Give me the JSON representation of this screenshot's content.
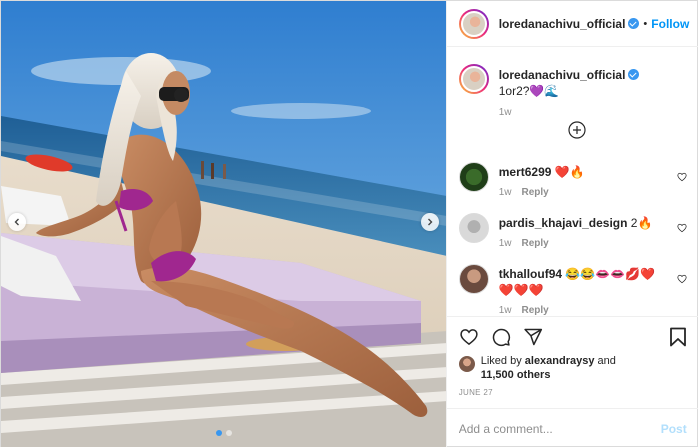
{
  "post": {
    "username": "loredanachivu_official",
    "follow_label": "Follow",
    "bullet": "•",
    "caption": "1or2?💜🌊",
    "caption_age": "1w",
    "comments": [
      {
        "user": "mert6299",
        "text": "❤️🔥",
        "age": "1w",
        "reply": "Reply"
      },
      {
        "user": "pardis_khajavi_design",
        "text": "2🔥",
        "age": "1w",
        "reply": "Reply"
      },
      {
        "user": "tkhallouf94",
        "text": "😂😂👄👄💋❤️❤️❤️❤️",
        "age": "1w",
        "reply": "Reply"
      }
    ],
    "liked_by_prefix": "Liked by",
    "liked_by_user": "alexandraysy",
    "liked_by_and": "and",
    "likes_count": "11,500 others",
    "date": "JUNE 27",
    "comment_placeholder": "Add a comment...",
    "post_label": "Post"
  },
  "carousel": {
    "slide_count": 2,
    "active_slide": 1
  },
  "colors": {
    "accent": "#0095f6",
    "verified": "#3897f0",
    "post_disabled": "#b2dffc",
    "muted": "#8e8e8e"
  },
  "icons": [
    "chevron-left-icon",
    "chevron-right-icon",
    "verified-badge-icon",
    "add-circle-icon",
    "heart-icon",
    "comment-icon",
    "share-icon",
    "bookmark-icon"
  ]
}
